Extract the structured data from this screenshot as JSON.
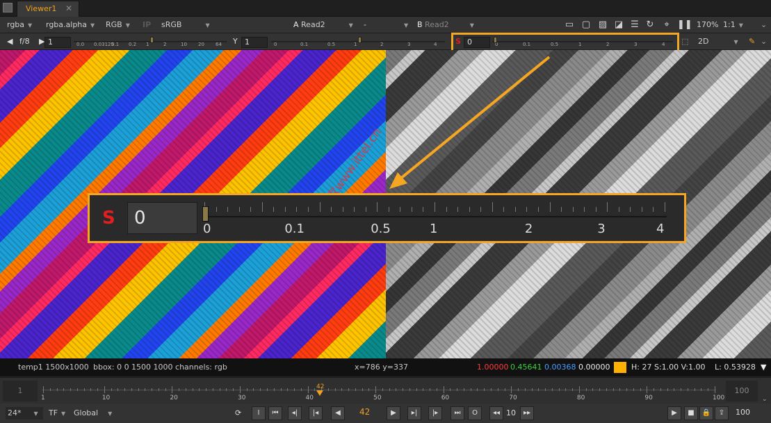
{
  "window": {
    "tab_title": "Viewer1",
    "tab_close": "✕"
  },
  "toolbar1": {
    "channels": "rgba",
    "layer": "rgba.alpha",
    "display": "RGB",
    "ip": "IP",
    "lut": "sRGB",
    "a_label": "A",
    "a_input": "Read2",
    "composite": "-",
    "b_label": "B",
    "b_input": "Read2",
    "zoom": "170%",
    "ratio": "1:1",
    "icons": [
      "roi-icon",
      "frame-icon",
      "checker-icon",
      "overlay-icon",
      "list-icon",
      "refresh-icon",
      "center-icon",
      "pause-icon"
    ]
  },
  "toolbar2": {
    "fstop_label": "f/8",
    "gain_value": "1",
    "gain_ticks": [
      "0.0",
      "0.03125",
      "0.1",
      "0.2",
      "1",
      "2",
      "10",
      "20",
      "64"
    ],
    "gamma_label": "Y",
    "gamma_value": "1",
    "gamma_ticks": [
      "0",
      "0.1",
      "0.5",
      "1",
      "2",
      "3",
      "4"
    ],
    "sat_label": "S",
    "sat_value": "0",
    "sat_ticks": [
      "0",
      "0.1",
      "0.5",
      "1",
      "2",
      "3",
      "4"
    ],
    "view_mode": "2D"
  },
  "zoom_panel": {
    "label": "S",
    "value": "0",
    "ticks": [
      "0",
      "0.1",
      "0.5",
      "1",
      "2",
      "3",
      "4"
    ]
  },
  "watermark": "IT技术之家www.ittel.cn",
  "info": {
    "node": "temp1 1500x1000",
    "bbox": "bbox: 0 0 1500 1000 channels: rgb",
    "coords": "x=786 y=337",
    "r": "1.00000",
    "g": "0.45641",
    "b": "0.00368",
    "a": "0.00000",
    "hsv": "H: 27 S:1.00 V:1.00",
    "lum": "L: 0.53928",
    "colors": {
      "r": "#ff3b3b",
      "g": "#3ed13e",
      "b": "#4a9cff",
      "swatch": "#ffb000"
    }
  },
  "timeline": {
    "start": "1",
    "end": "100",
    "current": "42",
    "labels": [
      "1",
      "10",
      "20",
      "30",
      "40",
      "50",
      "60",
      "70",
      "80",
      "90",
      "100"
    ]
  },
  "playback": {
    "fps": "24*",
    "tf": "TF",
    "scope": "Global",
    "frame": "42",
    "step": "10",
    "end_frame": "100",
    "buttons": [
      "in",
      "first",
      "prev-key",
      "prev",
      "play-back",
      "play",
      "next",
      "next-key",
      "last",
      "out"
    ]
  }
}
